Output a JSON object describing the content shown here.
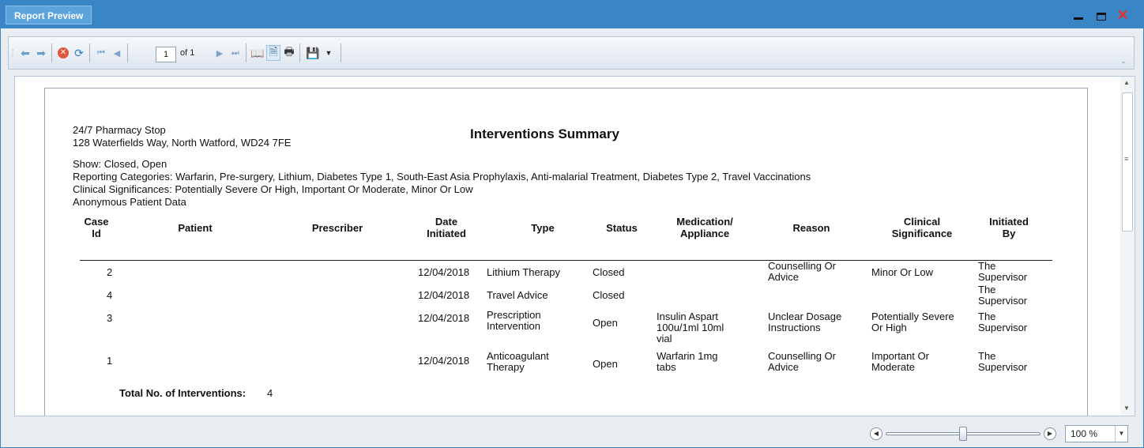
{
  "window": {
    "title": "Report Preview"
  },
  "toolbar": {
    "page_current": "1",
    "page_of": "of 1"
  },
  "report": {
    "pharmacy_name": "24/7 Pharmacy Stop",
    "pharmacy_address": "128 Waterfields Way, North Watford, WD24 7FE",
    "title": "Interventions Summary",
    "show": "Show: Closed, Open",
    "reporting_categories": "Reporting Categories: Warfarin, Pre-surgery, Lithium, Diabetes Type 1, South-East Asia Prophylaxis, Anti-malarial Treatment, Diabetes Type 2, Travel Vaccinations",
    "clinical_significances": "Clinical Significances: Potentially Severe Or High, Important Or Moderate, Minor Or Low",
    "anonymous": "Anonymous Patient Data",
    "columns": [
      "Case\nId",
      "Patient",
      "Prescriber",
      "Date\nInitiated",
      "Type",
      "Status",
      "Medication/\nAppliance",
      "Reason",
      "Clinical\nSignificance",
      "Initiated\nBy"
    ],
    "rows": [
      {
        "case_id": "2",
        "patient": "",
        "prescriber": "",
        "date": "12/04/2018",
        "type": "Lithium Therapy",
        "status": "Closed",
        "medication": "",
        "reason": "Counselling Or\nAdvice",
        "significance": "Minor Or Low",
        "initiated_by": "The\nSupervisor"
      },
      {
        "case_id": "4",
        "patient": "",
        "prescriber": "",
        "date": "12/04/2018",
        "type": "Travel Advice",
        "status": "Closed",
        "medication": "",
        "reason": "",
        "significance": "",
        "initiated_by": "The\nSupervisor"
      },
      {
        "case_id": "3",
        "patient": "",
        "prescriber": "",
        "date": "12/04/2018",
        "type": "Prescription\nIntervention",
        "status": "Open",
        "medication": "Insulin Aspart\n100u/1ml 10ml\nvial",
        "reason": "Unclear Dosage\nInstructions",
        "significance": "Potentially Severe\nOr High",
        "initiated_by": "The\nSupervisor"
      },
      {
        "case_id": "1",
        "patient": "",
        "prescriber": "",
        "date": "12/04/2018",
        "type": "Anticoagulant\nTherapy",
        "status": "Open",
        "medication": "Warfarin 1mg\ntabs",
        "reason": "Counselling Or\nAdvice",
        "significance": "Important Or\nModerate",
        "initiated_by": "The\nSupervisor"
      }
    ],
    "total_label": "Total No. of Interventions:",
    "total_value": "4"
  },
  "zoom": {
    "level": "100 %",
    "slider_fraction": 0.5
  },
  "colors": {
    "titlebar": "#3a85c6",
    "close": "#e0332a"
  }
}
